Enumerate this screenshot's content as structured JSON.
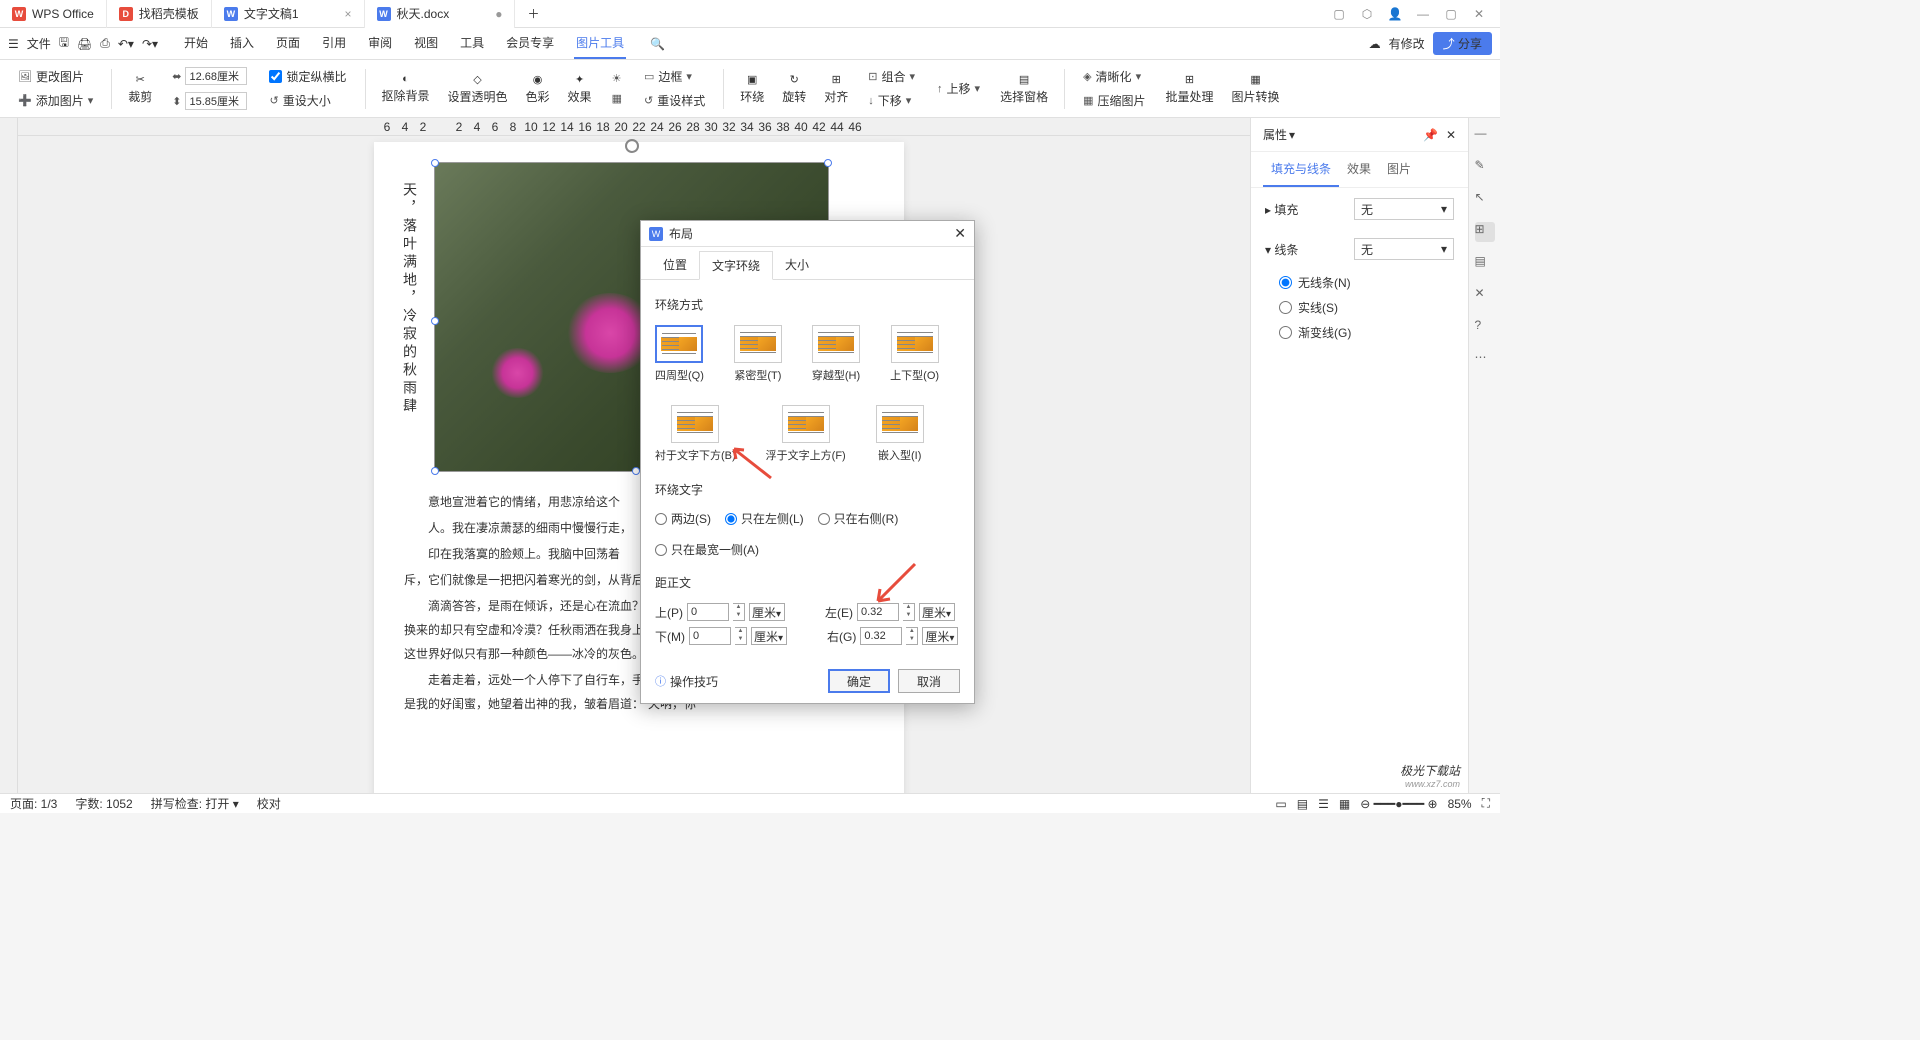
{
  "titlebar": {
    "app": "WPS Office",
    "tabs": [
      {
        "icon": "D",
        "color": "#e74c3c",
        "label": "找稻壳模板"
      },
      {
        "icon": "W",
        "color": "#4b7bec",
        "label": "文字文稿1"
      },
      {
        "icon": "W",
        "color": "#4b7bec",
        "label": "秋天.docx",
        "active": true
      }
    ]
  },
  "menubar": {
    "file": "文件",
    "tabs": [
      "开始",
      "插入",
      "页面",
      "引用",
      "审阅",
      "视图",
      "工具",
      "会员专享",
      "图片工具"
    ],
    "active": "图片工具",
    "modified": "有修改",
    "share": "分享"
  },
  "ribbon": {
    "change_img": "更改图片",
    "add_img": "添加图片",
    "crop": "裁剪",
    "width": "12.68厘米",
    "height": "15.85厘米",
    "lock_ratio": "锁定纵横比",
    "reset_size": "重设大小",
    "remove_bg": "抠除背景",
    "set_transparent": "设置透明色",
    "color": "色彩",
    "effect": "效果",
    "border": "边框",
    "reset_style": "重设样式",
    "wrap": "环绕",
    "rotate": "旋转",
    "align": "对齐",
    "group": "组合",
    "move_up": "上移",
    "move_down": "下移",
    "selection_pane": "选择窗格",
    "clarity": "清晰化",
    "compress": "压缩图片",
    "batch": "批量处理",
    "convert": "图片转换"
  },
  "ruler": [
    "6",
    "4",
    "2",
    "",
    "2",
    "4",
    "6",
    "8",
    "10",
    "12",
    "14",
    "16",
    "18",
    "20",
    "22",
    "24",
    "26",
    "28",
    "30",
    "32",
    "34",
    "36",
    "38",
    "40",
    "42",
    "44",
    "46"
  ],
  "document": {
    "vertical": "天，落叶满地，冷寂的秋雨肆",
    "p1": "意地宣泄着它的情绪，用悲凉给这个",
    "p2": "人。我在凄凉萧瑟的细雨中慢慢行走，",
    "p3": "印在我落寞的脸颊上。我脑中回荡着",
    "p4": "斥，它们就像是一把把闪着寒光的剑，从背后深深地刺进我的心脏。",
    "p5": "滴滴答答，是雨在倾诉，还是心在流血？一片黯然浮于眼眸，为什么我用真挚付出的换来的却只有空虚和冷漠？任秋雨洒在我身上，任枯黄而又不知名的叶子从我身旁飘落，这世界好似只有那一种颜色——冰冷的灰色。望向灰濛濛的天空，眼前逐渐泪眼朦胧。",
    "p6": "走着走着，远处一个人停下了自行车，手中撑着一把伞，匆匆向我走来。近看走来的是我的好闺蜜，她望着出神的我，皱着眉道：“天呐，你"
  },
  "dialog": {
    "title": "布局",
    "tabs": [
      "位置",
      "文字环绕",
      "大小"
    ],
    "active_tab": "文字环绕",
    "wrap_style": "环绕方式",
    "wrap_options": [
      "四周型(Q)",
      "紧密型(T)",
      "穿越型(H)",
      "上下型(O)",
      "衬于文字下方(B)",
      "浮于文字上方(F)",
      "嵌入型(I)"
    ],
    "wrap_text": "环绕文字",
    "text_options": [
      "两边(S)",
      "只在左侧(L)",
      "只在右侧(R)",
      "只在最宽一侧(A)"
    ],
    "selected_text": "只在左侧(L)",
    "distance": "距正文",
    "top": "上(P)",
    "top_val": "0",
    "bottom": "下(M)",
    "bottom_val": "0",
    "left": "左(E)",
    "left_val": "0.32",
    "right": "右(G)",
    "right_val": "0.32",
    "unit": "厘米",
    "tips": "操作技巧",
    "ok": "确定",
    "cancel": "取消"
  },
  "right_panel": {
    "title": "属性",
    "tabs": [
      "填充与线条",
      "效果",
      "图片"
    ],
    "active": "填充与线条",
    "fill": "填充",
    "fill_val": "无",
    "line": "线条",
    "line_val": "无",
    "line_opts": [
      "无线条(N)",
      "实线(S)",
      "渐变线(G)"
    ],
    "selected_line": "无线条(N)"
  },
  "statusbar": {
    "page": "页面: 1/3",
    "words": "字数: 1052",
    "spell": "拼写检查: 打开",
    "proof": "校对",
    "zoom": "85%"
  },
  "watermark": {
    "main": "极光下载站",
    "sub": "www.xz7.com"
  }
}
